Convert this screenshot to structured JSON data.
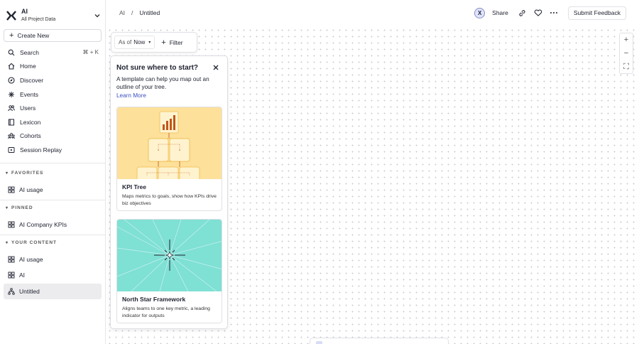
{
  "org": {
    "name": "AI",
    "subtitle": "All Project Data"
  },
  "sidebar": {
    "create_label": "Create New",
    "nav": [
      {
        "label": "Search",
        "shortcut": "⌘ + K",
        "icon": "search-icon"
      },
      {
        "label": "Home",
        "icon": "home-icon"
      },
      {
        "label": "Discover",
        "icon": "compass-icon"
      },
      {
        "label": "Events",
        "icon": "events-icon"
      },
      {
        "label": "Users",
        "icon": "users-icon"
      },
      {
        "label": "Lexicon",
        "icon": "book-icon"
      },
      {
        "label": "Cohorts",
        "icon": "cohorts-icon"
      },
      {
        "label": "Session Replay",
        "icon": "replay-icon"
      }
    ],
    "favorites_label": "FAVORITES",
    "favorites": [
      {
        "label": "AI usage",
        "icon": "board-icon"
      }
    ],
    "pinned_label": "PINNED",
    "pinned": [
      {
        "label": "AI Company KPIs",
        "icon": "board-icon"
      }
    ],
    "your_content_label": "YOUR CONTENT",
    "your_content": [
      {
        "label": "AI usage",
        "icon": "board-icon"
      },
      {
        "label": "AI",
        "icon": "board-icon"
      },
      {
        "label": "Untitled",
        "icon": "tree-icon"
      }
    ]
  },
  "breadcrumb": {
    "root": "AI",
    "sep": "/",
    "current": "Untitled"
  },
  "topbar": {
    "avatar_initial": "X",
    "share_label": "Share",
    "feedback_label": "Submit Feedback"
  },
  "filterbar": {
    "asof_label": "As of",
    "asof_value": "Now",
    "filter_label": "Filter"
  },
  "panel": {
    "title": "Not sure where to start?",
    "description": "A template can help you map out an outline of your tree.",
    "link": "Learn More",
    "cards": [
      {
        "title": "KPI Tree",
        "description": "Maps metrics to goals, show how KPIs drive biz objectives",
        "bg": "#fde09a"
      },
      {
        "title": "North Star Framework",
        "description": "Aligns teams to one key metric, a leading indicator for outputs",
        "bg": "#7fe0d4"
      }
    ]
  },
  "zoom_tools": {
    "zoom_in": "+",
    "zoom_out": "−",
    "fit": "⛶"
  },
  "colors": {
    "accent": "#3b4fc4",
    "bar": "#c0561b"
  }
}
